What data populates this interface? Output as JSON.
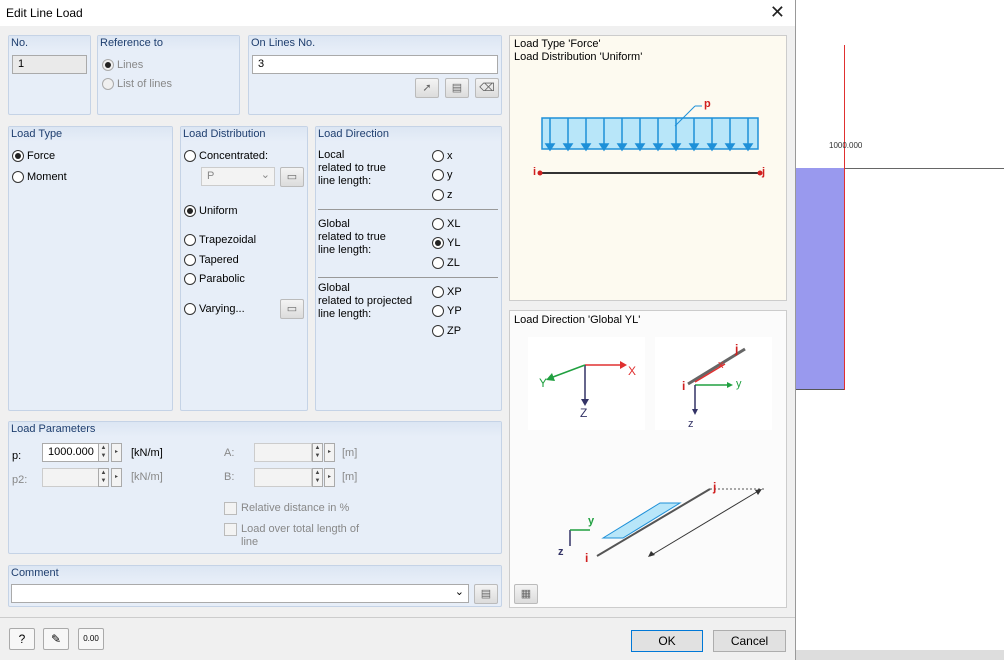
{
  "dialog": {
    "title": "Edit Line Load"
  },
  "no": {
    "label": "No.",
    "value": "1"
  },
  "reference": {
    "label": "Reference to",
    "lines": "Lines",
    "list": "List of lines"
  },
  "on_lines": {
    "label": "On Lines No.",
    "value": "3"
  },
  "load_type": {
    "label": "Load Type",
    "force": "Force",
    "moment": "Moment"
  },
  "load_dist": {
    "label": "Load Distribution",
    "concentrated": "Concentrated:",
    "select_value": "P",
    "uniform": "Uniform",
    "trapezoidal": "Trapezoidal",
    "tapered": "Tapered",
    "parabolic": "Parabolic",
    "varying": "Varying..."
  },
  "load_dir": {
    "label": "Load Direction",
    "local_text": "Local\nrelated to true\nline length:",
    "x": "x",
    "y": "y",
    "z": "z",
    "global_text": "Global\nrelated to true\nline length:",
    "XL": "XL",
    "YL": "YL",
    "ZL": "ZL",
    "proj_text": "Global\nrelated to projected\nline length:",
    "XP": "XP",
    "YP": "YP",
    "ZP": "ZP"
  },
  "params": {
    "label": "Load Parameters",
    "p_label": "p:",
    "p_value": "1000.000",
    "unit1": "[kN/m]",
    "p2_label": "p2:",
    "unit2": "[kN/m]",
    "A_label": "A:",
    "A_unit": "[m]",
    "B_label": "B:",
    "B_unit": "[m]",
    "relative": "Relative distance in %",
    "overtotal": "Load over total length of line"
  },
  "comment": {
    "label": "Comment"
  },
  "diagram1": {
    "line1": "Load Type 'Force'",
    "line2": "Load Distribution 'Uniform'",
    "p": "p",
    "i": "i",
    "j": "j"
  },
  "diagram2": {
    "title": "Load Direction 'Global YL'"
  },
  "buttons": {
    "ok": "OK",
    "cancel": "Cancel"
  },
  "bg": {
    "value": "1000.000"
  }
}
